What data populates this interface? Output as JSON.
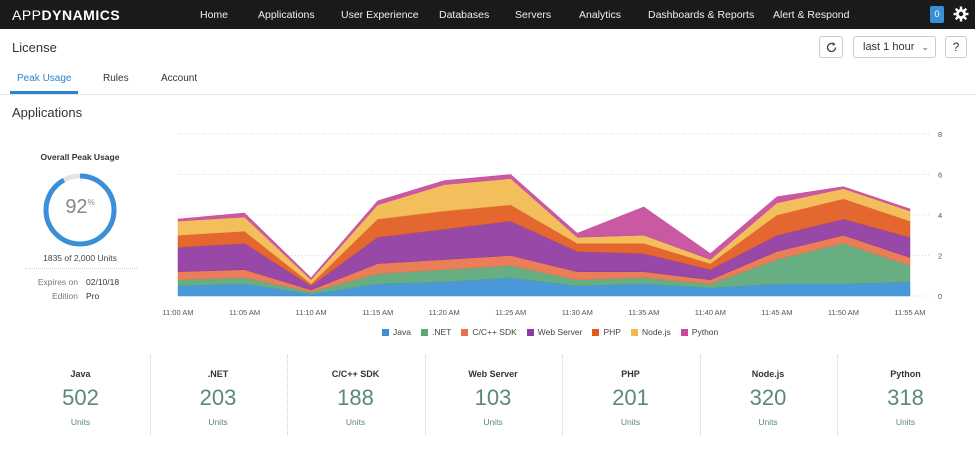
{
  "brand": {
    "part1": "APP",
    "part2": "DYNAMICS"
  },
  "nav": {
    "items": [
      {
        "label": "Home"
      },
      {
        "label": "Applications"
      },
      {
        "label": "User Experience"
      },
      {
        "label": "Databases"
      },
      {
        "label": "Servers"
      },
      {
        "label": "Analytics"
      },
      {
        "label": "Dashboards & Reports"
      },
      {
        "label": "Alert & Respond"
      }
    ],
    "notification_count": "0",
    "settings_icon": "gear-icon"
  },
  "header": {
    "title": "License",
    "time_range": "last 1 hour",
    "help_label": "?",
    "refresh_icon": "refresh-icon"
  },
  "tabs": [
    {
      "label": "Peak Usage",
      "active": true
    },
    {
      "label": "Rules",
      "active": false
    },
    {
      "label": "Account",
      "active": false
    }
  ],
  "section_title": "Applications",
  "summary": {
    "title": "Overall Peak Usage",
    "percent": "92",
    "percent_sign": "%",
    "percent_value": 0.92,
    "units_text": "1835 of 2,000  Units",
    "expires_label": "Expires on",
    "expires_value": "02/10/18",
    "edition_label": "Edition",
    "edition_value": "Pro"
  },
  "colors": {
    "Java": "#3b8fd5",
    "NET": "#5aa878",
    "CppSDK": "#e8734a",
    "WebServer": "#8f3aa0",
    "PHP": "#e25a1e",
    "Nodejs": "#f2b84e",
    "Python": "#c64b9c",
    "gauge": "#3a8fd9"
  },
  "chart_data": {
    "type": "area",
    "stacked": true,
    "x": [
      "11:00 AM",
      "11:05 AM",
      "11:10 AM",
      "11:15 AM",
      "11:20 AM",
      "11:25 AM",
      "11:30 AM",
      "11:35 AM",
      "11:40 AM",
      "11:45 AM",
      "11:50 AM",
      "11:55 AM"
    ],
    "ylim": [
      0,
      8
    ],
    "yticks": [
      "0",
      "2",
      "4",
      "6",
      "8"
    ],
    "grid": true,
    "legend_position": "bottom",
    "series": [
      {
        "name": "Java",
        "color": "#3b8fd5",
        "values": [
          0.5,
          0.6,
          0.1,
          0.6,
          0.7,
          0.9,
          0.5,
          0.6,
          0.4,
          0.6,
          0.6,
          0.7
        ]
      },
      {
        "name": ".NET",
        "color": "#5aa878",
        "values": [
          0.3,
          0.3,
          0.1,
          0.5,
          0.6,
          0.6,
          0.3,
          0.3,
          0.2,
          1.2,
          2.0,
          0.8
        ]
      },
      {
        "name": "C/C++ SDK",
        "color": "#e8734a",
        "values": [
          0.4,
          0.4,
          0.1,
          0.5,
          0.5,
          0.5,
          0.4,
          0.3,
          0.2,
          0.4,
          0.4,
          0.4
        ]
      },
      {
        "name": "Web Server",
        "color": "#8f3aa0",
        "values": [
          1.2,
          1.3,
          0.2,
          1.3,
          1.5,
          1.7,
          1.0,
          0.9,
          0.5,
          0.8,
          0.8,
          1.0
        ]
      },
      {
        "name": "PHP",
        "color": "#e25a1e",
        "values": [
          0.6,
          0.6,
          0.1,
          0.9,
          0.9,
          0.8,
          0.4,
          0.5,
          0.3,
          1.0,
          1.0,
          0.8
        ]
      },
      {
        "name": "Node.js",
        "color": "#f2b84e",
        "values": [
          0.7,
          0.7,
          0.2,
          0.7,
          1.3,
          1.3,
          0.3,
          0.4,
          0.2,
          0.6,
          0.5,
          0.5
        ]
      },
      {
        "name": "Python",
        "color": "#c64b9c",
        "values": [
          0.1,
          0.2,
          0.1,
          0.2,
          0.2,
          0.2,
          0.2,
          1.4,
          0.3,
          0.3,
          0.1,
          0.1
        ]
      }
    ]
  },
  "stats": [
    {
      "name": "Java",
      "value": "502",
      "units": "Units"
    },
    {
      "name": ".NET",
      "value": "203",
      "units": "Units"
    },
    {
      "name": "C/C++ SDK",
      "value": "188",
      "units": "Units"
    },
    {
      "name": "Web Server",
      "value": "103",
      "units": "Units"
    },
    {
      "name": "PHP",
      "value": "201",
      "units": "Units"
    },
    {
      "name": "Node.js",
      "value": "320",
      "units": "Units"
    },
    {
      "name": "Python",
      "value": "318",
      "units": "Units"
    }
  ]
}
